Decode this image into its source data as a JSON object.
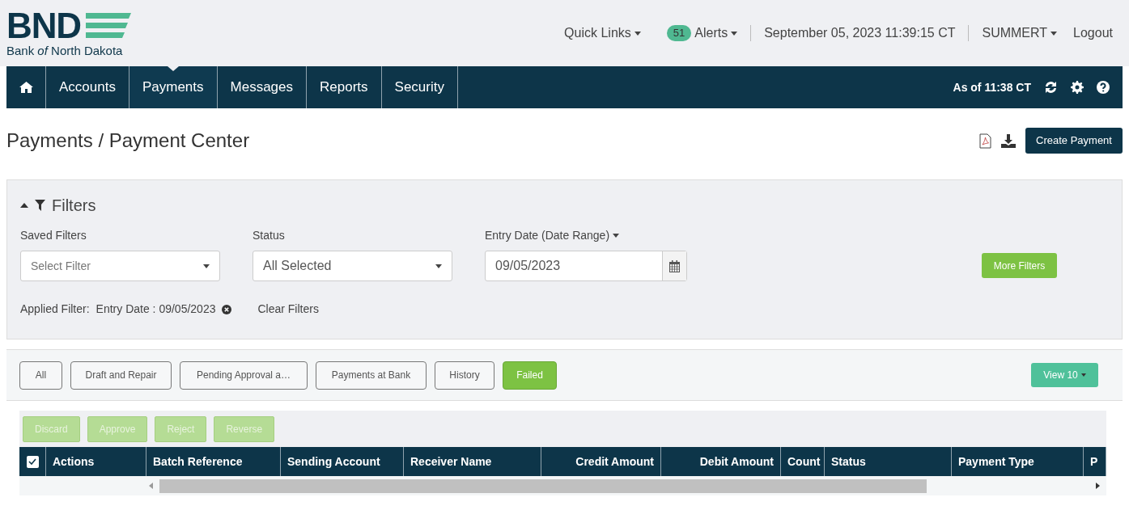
{
  "logo": {
    "mark": "BND",
    "subtitle": "Bank *of* North Dakota"
  },
  "top_links": {
    "quick_links": "Quick Links",
    "alerts_count": "51",
    "alerts": "Alerts",
    "datetime": "September 05, 2023 11:39:15 CT",
    "user": "SUMMERT",
    "logout": "Logout"
  },
  "nav": {
    "items": [
      {
        "label": "Accounts",
        "selected": false
      },
      {
        "label": "Payments",
        "selected": true
      },
      {
        "label": "Messages",
        "selected": false
      },
      {
        "label": "Reports",
        "selected": false
      },
      {
        "label": "Security",
        "selected": false
      }
    ],
    "as_of": "As of 11:38 CT"
  },
  "page_title": "Payments / Payment Center",
  "create_button": "Create Payment",
  "filters": {
    "title": "Filters",
    "expanded": true,
    "fields": [
      {
        "kind": "select",
        "label": "Saved Filters",
        "placeholder": "Select Filter"
      },
      {
        "kind": "select",
        "label": "Status",
        "value": "All  Selected"
      },
      {
        "kind": "date",
        "label": "Entry Date (Date Range)",
        "value": "09/05/2023"
      }
    ],
    "more_button": "More Filters",
    "applied_label": "Applied Filter:",
    "applied_chip": "Entry Date : 09/05/2023",
    "clear": "Clear Filters"
  },
  "tabs": [
    {
      "label": "All",
      "selected": false
    },
    {
      "label": "Draft and Repair",
      "selected": false
    },
    {
      "label": "Pending Approval a…",
      "selected": false
    },
    {
      "label": "Payments at Bank",
      "selected": false
    },
    {
      "label": "History",
      "selected": false
    },
    {
      "label": "Failed",
      "selected": true
    }
  ],
  "view_button": "View 10",
  "actions": [
    {
      "label": "Discard",
      "disabled": true
    },
    {
      "label": "Approve",
      "disabled": true
    },
    {
      "label": "Reject",
      "disabled": true
    },
    {
      "label": "Reverse",
      "disabled": true
    }
  ],
  "table": {
    "select_all_checked": true,
    "columns": [
      {
        "label": "Actions",
        "kind": "text"
      },
      {
        "label": "Batch Reference",
        "kind": "text"
      },
      {
        "label": "Sending Account",
        "kind": "text"
      },
      {
        "label": "Receiver Name",
        "kind": "text"
      },
      {
        "label": "Credit Amount",
        "kind": "amount"
      },
      {
        "label": "Debit Amount",
        "kind": "amount"
      },
      {
        "label": "Count",
        "kind": "text"
      },
      {
        "label": "Status",
        "kind": "text"
      },
      {
        "label": "Payment Type",
        "kind": "text"
      },
      {
        "label": "P",
        "kind": "text"
      }
    ]
  }
}
